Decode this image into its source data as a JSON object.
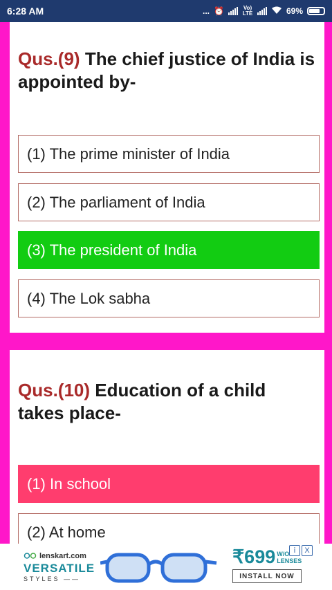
{
  "status": {
    "time": "6:28 AM",
    "dots": "...",
    "net_label": "Vo) LTE",
    "battery": "69%"
  },
  "questions": [
    {
      "number": "Qus.(9)",
      "text": "The chief justice of India is appointed by-",
      "options": [
        {
          "label": "(1) The prime minister of India",
          "state": "normal"
        },
        {
          "label": "(2) The parliament of India",
          "state": "normal"
        },
        {
          "label": "(3) The president of India",
          "state": "correct"
        },
        {
          "label": "(4) The Lok sabha",
          "state": "normal"
        }
      ]
    },
    {
      "number": "Qus.(10)",
      "text": "Education of a child takes place-",
      "options": [
        {
          "label": "(1) In school",
          "state": "wrong"
        },
        {
          "label": "(2) At home",
          "state": "normal"
        }
      ]
    }
  ],
  "ad": {
    "brand": "lenskart.com",
    "headline": "VERSATILE",
    "sub": "STYLES",
    "price": "₹699",
    "price_note": "W/O LENSES",
    "cta": "INSTALL NOW",
    "info_icon": "i",
    "close_icon": "X"
  },
  "colors": {
    "status_bar": "#1f3a6e",
    "page_bg": "#ff17c9",
    "correct": "#12cc12",
    "wrong": "#ff3d6e",
    "question_number": "#a92a2a"
  }
}
